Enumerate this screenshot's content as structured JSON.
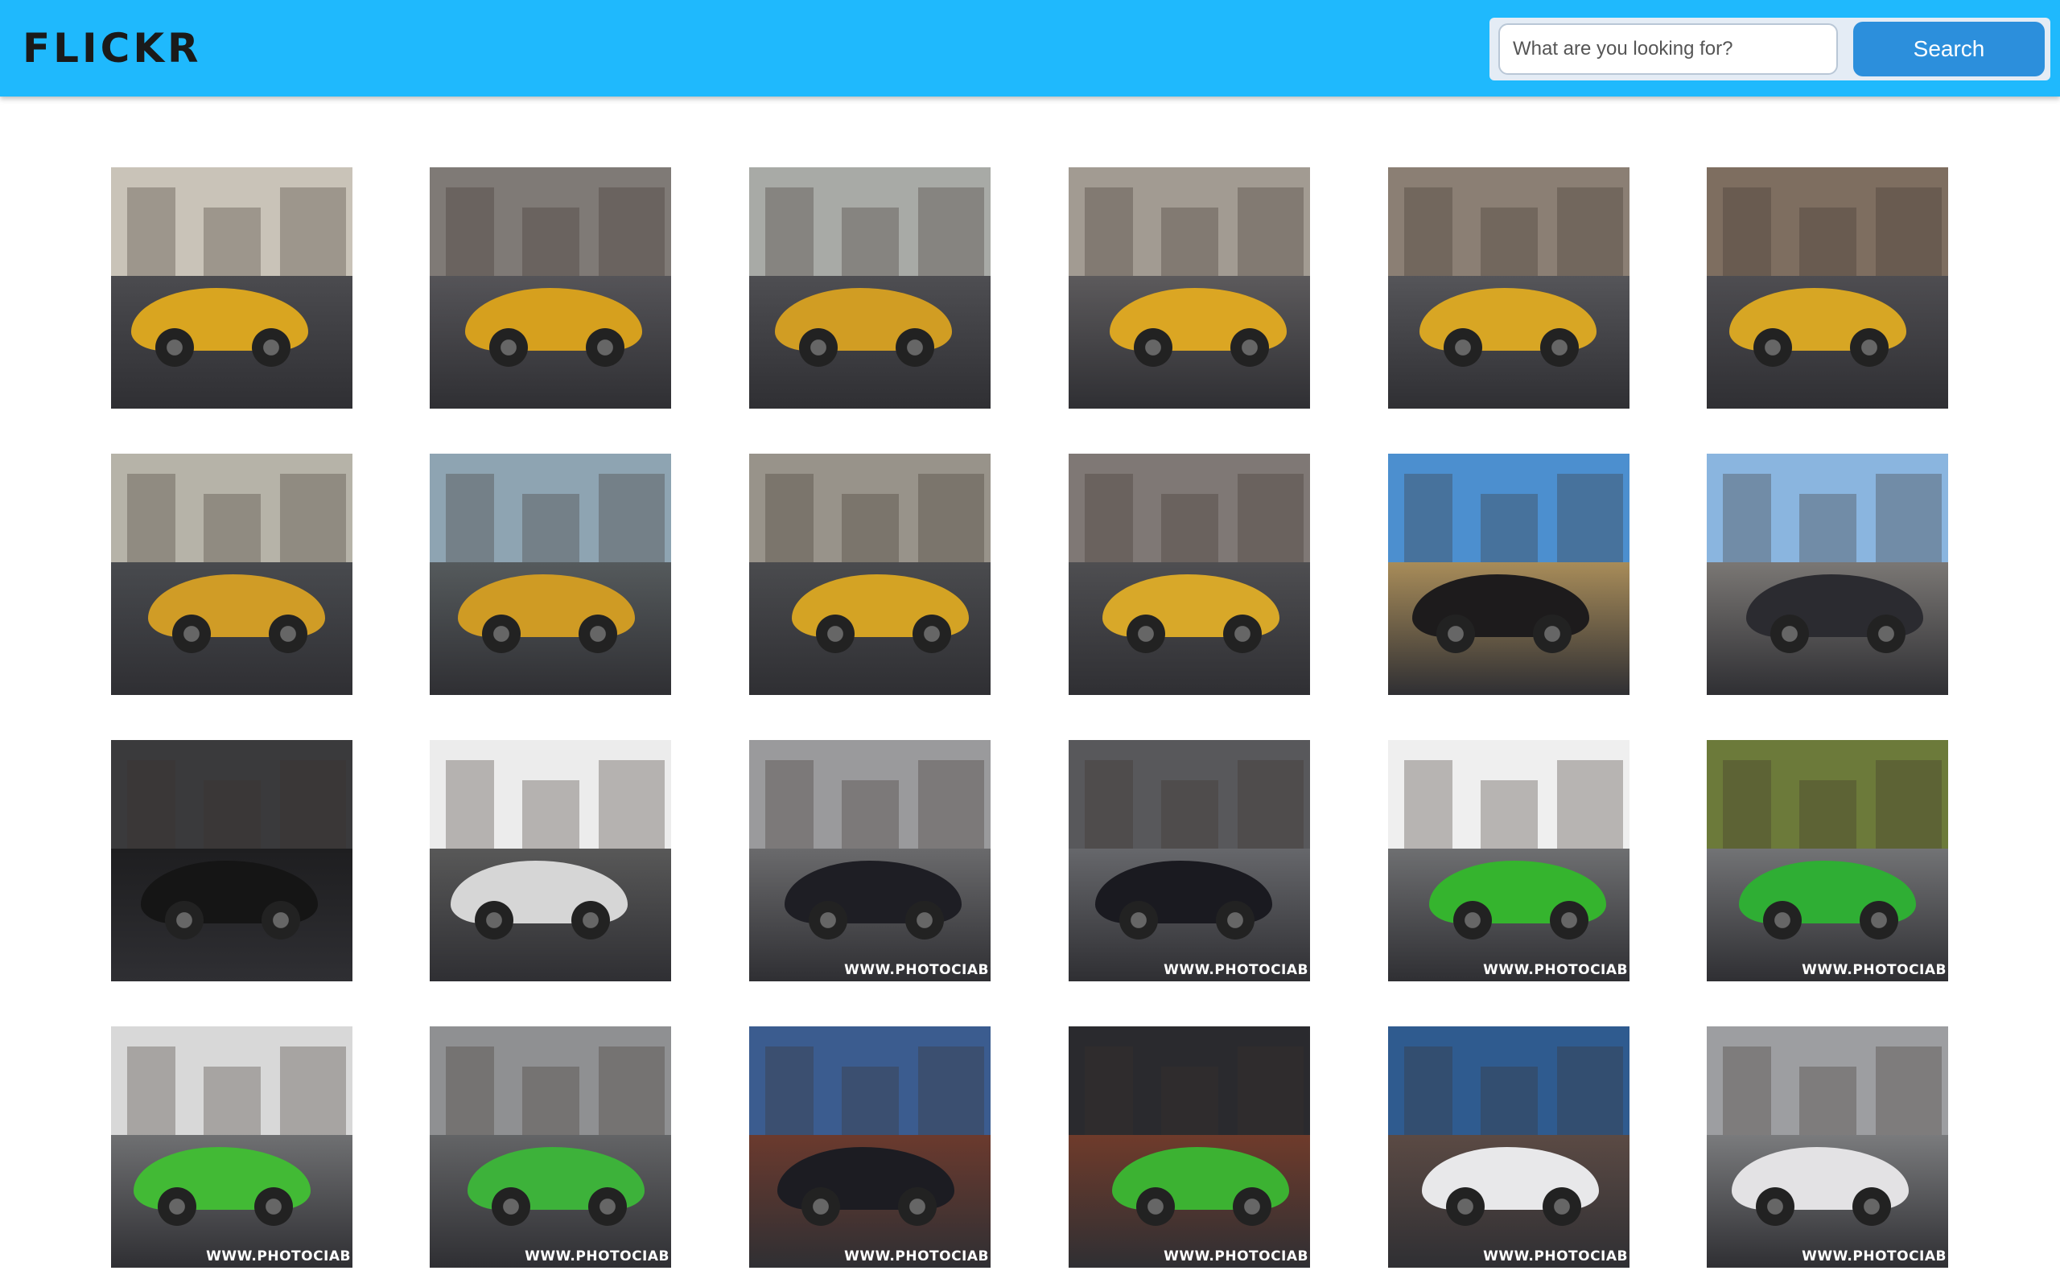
{
  "header": {
    "logo": "FLICKR",
    "search_placeholder": "What are you looking for?",
    "search_button": "Search"
  },
  "watermark_text": "WWW.PHOTOCIAB",
  "photos": [
    {
      "label": "yellow-lamborghini-huracan-rear",
      "car": "#d9a520",
      "sky": "#c9c3b8",
      "ground": "#4b4b4f"
    },
    {
      "label": "yellow-lamborghini-huracan-rear-quarter",
      "car": "#d6a01e",
      "sky": "#7f7a76",
      "ground": "#555458"
    },
    {
      "label": "yellow-lamborghini-huracan-city",
      "car": "#d19d23",
      "sky": "#a8aaa6",
      "ground": "#4e4e52"
    },
    {
      "label": "yellow-lamborghini-huracan-front",
      "car": "#dba623",
      "sky": "#a29b92",
      "ground": "#5c5a5c"
    },
    {
      "label": "yellow-lamborghini-huracan-side",
      "car": "#d8a624",
      "sky": "#8b7f74",
      "ground": "#555559"
    },
    {
      "label": "yellow-lamborghini-huracan-front-quarter",
      "car": "#d7a624",
      "sky": "#7e6e60",
      "ground": "#4e4d51"
    },
    {
      "label": "yellow-lamborghini-huracan-street",
      "car": "#d09c26",
      "sky": "#b6b3a8",
      "ground": "#484a4e"
    },
    {
      "label": "yellow-lamborghini-huracan-harbor",
      "car": "#cf9b24",
      "sky": "#8ea4b2",
      "ground": "#555a5c"
    },
    {
      "label": "yellow-lamborghini-huracan-downtown",
      "car": "#d4a324",
      "sky": "#98938a",
      "ground": "#4a4b4e"
    },
    {
      "label": "yellow-lamborghini-huracan-profile",
      "car": "#d8a829",
      "sky": "#7f7875",
      "ground": "#4e4e51"
    },
    {
      "label": "black-lamborghini-aventador-rear",
      "car": "#1d1b1c",
      "sky": "#4c8fcf",
      "ground": "#a88c59"
    },
    {
      "label": "black-lamborghini-aventador-doors-open",
      "car": "#2b2b30",
      "sky": "#8ab5df",
      "ground": "#7a7774"
    },
    {
      "label": "black-lamborghini-detail",
      "car": "#151515",
      "sky": "#3a3a3c",
      "ground": "#1e1e20"
    },
    {
      "label": "white-lamborghini-wheel",
      "car": "#d6d6d6",
      "sky": "#ececec",
      "ground": "#585858"
    },
    {
      "label": "black-huracan-super-trofeo-track",
      "car": "#1e1e24",
      "sky": "#9a9a9c",
      "ground": "#6a6a6c",
      "watermark": true
    },
    {
      "label": "black-huracan-super-trofeo-front",
      "car": "#1a1a20",
      "sky": "#58585b",
      "ground": "#66676b",
      "watermark": true
    },
    {
      "label": "green-huracan-gt3-audi-sport",
      "car": "#35b42e",
      "sky": "#efefef",
      "ground": "#6e6f71",
      "watermark": true
    },
    {
      "label": "green-huracan-gt3-curve",
      "car": "#2fae34",
      "sky": "#6c7a3a",
      "ground": "#727375",
      "watermark": true
    },
    {
      "label": "green-huracan-gt3-corner",
      "car": "#42ba35",
      "sky": "#d8d8d8",
      "ground": "#6f7072",
      "watermark": true
    },
    {
      "label": "green-huracan-gt3-chasing",
      "car": "#3db23a",
      "sky": "#8f9092",
      "ground": "#636466",
      "watermark": true
    },
    {
      "label": "black-huracan-pit-garage",
      "car": "#1c1c22",
      "sky": "#3b5c8f",
      "ground": "#6b3a2e",
      "watermark": true
    },
    {
      "label": "green-huracan-antonelli-motorsport",
      "car": "#3cb232",
      "sky": "#2a2a2e",
      "ground": "#6f3b2b",
      "watermark": true
    },
    {
      "label": "white-huracan-antonelli-garage",
      "car": "#e8e8ea",
      "sky": "#2f5b8f",
      "ground": "#5b4a44",
      "watermark": true
    },
    {
      "label": "white-huracan-track",
      "car": "#e3e2e4",
      "sky": "#9d9ea1",
      "ground": "#7a7b7d",
      "watermark": true
    }
  ]
}
